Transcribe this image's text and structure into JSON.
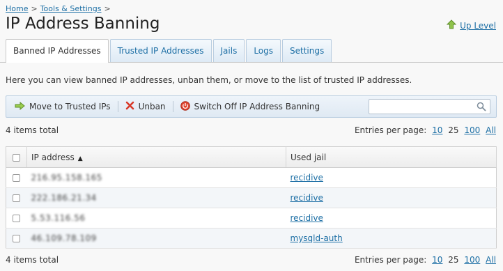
{
  "breadcrumb": {
    "home": "Home",
    "separator": ">",
    "tools": "Tools & Settings",
    "trailing": ">"
  },
  "page_title": "IP Address Banning",
  "up_level": "Up Level",
  "tabs": [
    {
      "label": "Banned IP Addresses",
      "active": true
    },
    {
      "label": "Trusted IP Addresses",
      "active": false
    },
    {
      "label": "Jails",
      "active": false
    },
    {
      "label": "Logs",
      "active": false
    },
    {
      "label": "Settings",
      "active": false
    }
  ],
  "description": "Here you can view banned IP addresses, unban them, or move to the list of trusted IP addresses.",
  "toolbar": {
    "move_label": "Move to Trusted IPs",
    "unban_label": "Unban",
    "switch_off_label": "Switch Off IP Address Banning",
    "search_placeholder": ""
  },
  "totals": "4 items total",
  "entries": {
    "label": "Entries per page:",
    "options": [
      "10",
      "25",
      "100",
      "All"
    ],
    "current": "25"
  },
  "table": {
    "headers": {
      "ip": "IP address",
      "jail": "Used jail"
    },
    "sort_indicator": "▲",
    "rows": [
      {
        "ip": "216.95.158.165",
        "jail": "recidive"
      },
      {
        "ip": "222.186.21.34",
        "jail": "recidive"
      },
      {
        "ip": "5.53.116.56",
        "jail": "recidive"
      },
      {
        "ip": "46.109.78.109",
        "jail": "mysqld-auth"
      }
    ]
  },
  "colors": {
    "link": "#1d6fa5",
    "toolbar_bg": "#dfe9f3",
    "border": "#b9cde0"
  }
}
